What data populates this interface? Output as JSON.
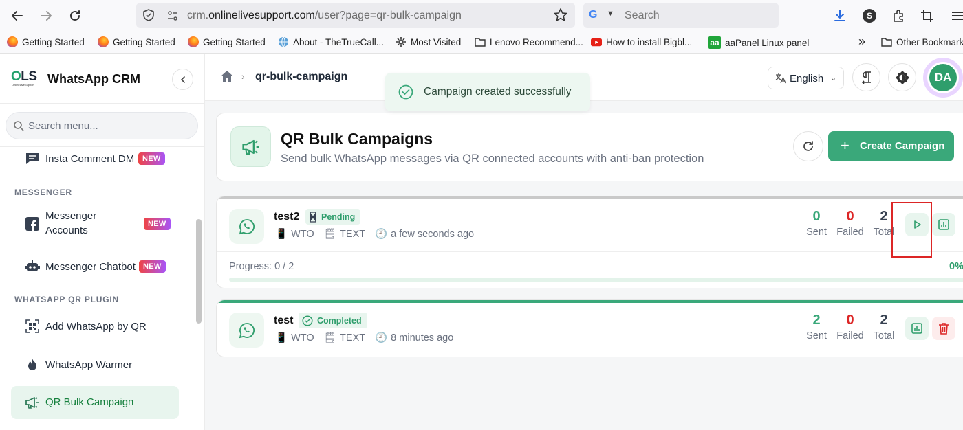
{
  "browser": {
    "url_prefix": "crm.",
    "url_domain": "onlinelivesupport.com",
    "url_path": "/user?page=qr-bulk-campaign",
    "search_placeholder": "Search",
    "search_engine_icon": "G",
    "account_letter": "S"
  },
  "bookmarks": [
    {
      "label": "Getting Started",
      "icon": "firefox-icon"
    },
    {
      "label": "Getting Started",
      "icon": "firefox-icon"
    },
    {
      "label": "Getting Started",
      "icon": "firefox-icon"
    },
    {
      "label": "About - TheTrueCall...",
      "icon": "globe-icon"
    },
    {
      "label": "Most Visited",
      "icon": "gear-icon"
    },
    {
      "label": "Lenovo Recommend...",
      "icon": "folder-icon"
    },
    {
      "label": "How to install Bigbl...",
      "icon": "youtube-icon"
    },
    {
      "label": "aaPanel Linux panel",
      "icon": "aapanel-icon"
    },
    {
      "label": "Other Bookmarks",
      "icon": "folder-icon"
    }
  ],
  "bookmarks_overflow": "»",
  "app": {
    "logo_text_a": "O",
    "logo_text_b": "LS",
    "logo_sub": "OnlineLiveSupport",
    "brand": "WhatsApp CRM",
    "search_placeholder": "Search menu..."
  },
  "sidebar": {
    "items": [
      {
        "label": "Insta Comment DM",
        "badge": "NEW"
      },
      {
        "label": "Messenger Accounts",
        "badge": "NEW"
      },
      {
        "label": "Messenger Chatbot",
        "badge": "NEW"
      },
      {
        "label": "Add WhatsApp by QR"
      },
      {
        "label": "WhatsApp Warmer"
      },
      {
        "label": "QR Bulk Campaign"
      }
    ],
    "sections": [
      "MESSENGER",
      "WHATSAPP QR PLUGIN"
    ]
  },
  "header": {
    "breadcrumb_current": "qr-bulk-campaign",
    "language": "English",
    "avatar_initials": "DA"
  },
  "toast": {
    "message": "Campaign created successfully"
  },
  "page": {
    "title": "QR Bulk Campaigns",
    "subtitle": "Send bulk WhatsApp messages via QR connected accounts with anti-ban protection",
    "create_label": "Create Campaign",
    "plus": "+"
  },
  "campaigns": [
    {
      "name": "test2",
      "status": "Pending",
      "account": "WTO",
      "type": "TEXT",
      "time": "a few seconds ago",
      "sent": "0",
      "failed": "0",
      "total": "2",
      "labels": {
        "sent": "Sent",
        "failed": "Failed",
        "total": "Total"
      },
      "progress_label": "Progress: 0 / 2",
      "progress_pct": "0%",
      "progress_value": 0
    },
    {
      "name": "test",
      "status": "Completed",
      "account": "WTO",
      "type": "TEXT",
      "time": "8 minutes ago",
      "sent": "2",
      "failed": "0",
      "total": "2",
      "labels": {
        "sent": "Sent",
        "failed": "Failed",
        "total": "Total"
      }
    }
  ],
  "colors": {
    "accent": "#3aa87a",
    "success": "#2f9e6c",
    "danger": "#dc2626",
    "highlight_box": "#dc2626"
  }
}
